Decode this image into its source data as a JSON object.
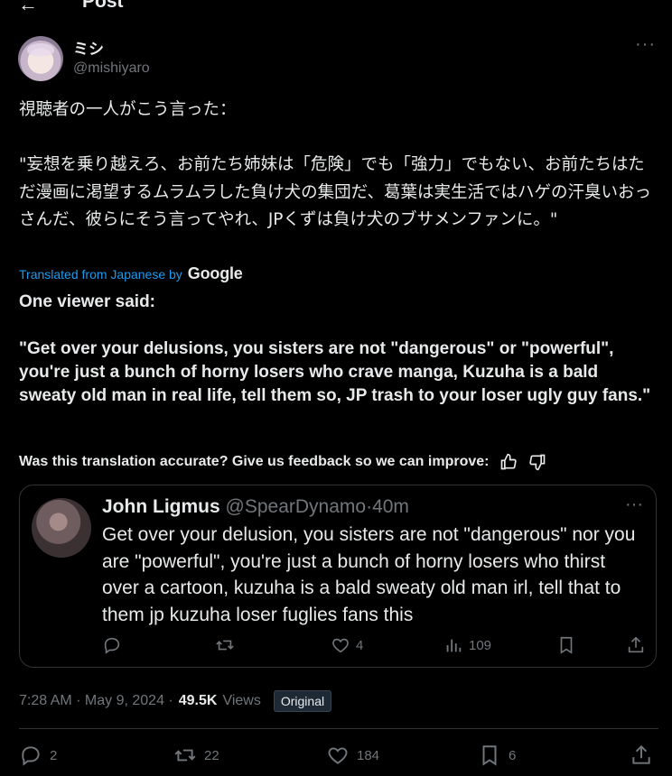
{
  "header": {
    "back_icon": "arrow-left-icon",
    "title": "Post"
  },
  "post": {
    "display_name": "ミシ",
    "handle": "@mishiyaro",
    "text_jp": "視聴者の一人がこう言った：\n\n\"妄想を乗り越えろ、お前たち姉妹は「危険」でも「強力」でもない、お前たちはただ漫画に渇望するムラムラした負け犬の集団だ、葛葉は実生活ではハゲの汗臭いおっさんだ、彼らにそう言ってやれ、JPくずは負け犬のブサメンファンに。\"",
    "translated_label": "Translated from Japanese by",
    "translator": "Google",
    "text_en": "One viewer said:\n\n\"Get over your delusions, you sisters are not \"dangerous\" or \"powerful\", you're just a bunch of horny losers who crave manga, Kuzuha is a bald sweaty old man in real life, tell them so, JP trash to your loser ugly guy fans.\"",
    "feedback_text": "Was this translation accurate? Give us feedback so we can improve:",
    "timestamp": "7:28 AM · May 9, 2024 ·",
    "views_count": "49.5K",
    "views_label": "Views",
    "original_badge": "Original",
    "actions": {
      "replies": "2",
      "reposts": "22",
      "likes": "184",
      "bookmarks": "6"
    }
  },
  "quote": {
    "name": "John Ligmus",
    "handle": "@SpearDynamo",
    "sep": "·",
    "age": "40m",
    "text": "Get over your delusion, you sisters are not \"dangerous\" nor you are \"powerful\", you're just a bunch of horny losers who thirst over a cartoon, kuzuha is a bald sweaty old man irl, tell that to them jp kuzuha loser fuglies fans this",
    "actions": {
      "replies": "",
      "reposts": "",
      "likes": "4",
      "views": "109"
    }
  },
  "colors": {
    "background": "#000000",
    "text": "#e7e9ea",
    "muted": "#71767b",
    "link": "#1d9bf0",
    "border": "#2f3336"
  }
}
